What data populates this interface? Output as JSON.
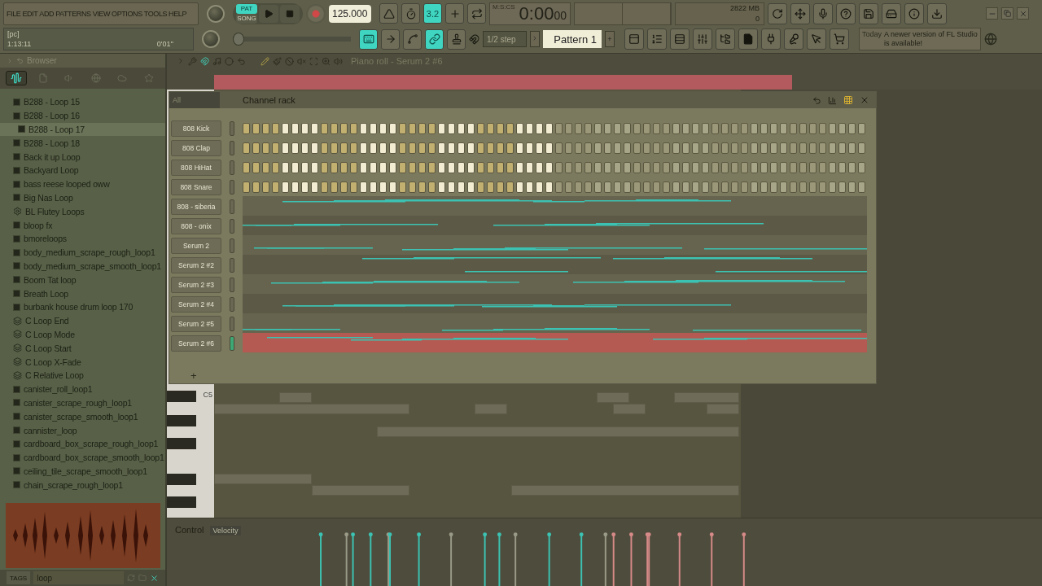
{
  "menu": [
    "FILE",
    "EDIT",
    "ADD",
    "PATTERNS",
    "VIEW",
    "OPTIONS",
    "TOOLS",
    "HELP"
  ],
  "hint": {
    "title": "[pc]",
    "position": "1:13:11",
    "time": "0'01''"
  },
  "modes": [
    {
      "label": "PAT",
      "selected": true
    },
    {
      "label": "SONG",
      "selected": false
    }
  ],
  "tempo": "125.000",
  "position": {
    "level": 0
  },
  "time": {
    "value": "0:00",
    "fraction": "00",
    "unit": "M:S:CS"
  },
  "tools_top": [
    {
      "kind": "metronome",
      "on": false
    },
    {
      "kind": "wait",
      "on": false
    },
    {
      "kind": "countdown",
      "on": true,
      "label": "3.2"
    },
    {
      "kind": "step-edit",
      "on": false
    },
    {
      "kind": "loop-record",
      "on": false
    }
  ],
  "memory": {
    "value": "2822 MB",
    "voices": "0"
  },
  "tools_bottom": [
    {
      "kind": "typing-keyboard",
      "on": true
    },
    {
      "kind": "arrow",
      "on": false
    },
    {
      "kind": "blend",
      "on": false
    },
    {
      "kind": "link",
      "on": true
    },
    {
      "kind": "stamp",
      "on": false
    }
  ],
  "snap": "1/2 step",
  "pattern": {
    "name": "Pattern 1",
    "add": "+"
  },
  "news": {
    "date": "Today",
    "message": "A newer version of FL Studio is available!"
  },
  "browser": {
    "title": "Browser",
    "tabs": [
      {
        "kind": "all",
        "selected": true
      },
      {
        "kind": "files",
        "selected": false
      },
      {
        "kind": "speaker",
        "selected": false
      },
      {
        "kind": "globe",
        "selected": false
      },
      {
        "kind": "cloud",
        "selected": false
      },
      {
        "kind": "star",
        "selected": false
      }
    ],
    "items": [
      {
        "label": "B288 - Loop 15",
        "kind": "audio",
        "selected": false
      },
      {
        "label": "B288 - Loop 16",
        "kind": "audio",
        "selected": false
      },
      {
        "label": "B288 - Loop 17",
        "kind": "audio",
        "selected": true
      },
      {
        "label": "B288 - Loop 18",
        "kind": "audio",
        "selected": false
      },
      {
        "label": "Back it up Loop",
        "kind": "audio",
        "selected": false
      },
      {
        "label": "Backyard Loop",
        "kind": "audio",
        "selected": false
      },
      {
        "label": "bass reese looped oww",
        "kind": "audio",
        "selected": false
      },
      {
        "label": "Big Nas Loop",
        "kind": "audio",
        "selected": false
      },
      {
        "label": "BL Flutey Loops",
        "kind": "folder",
        "selected": false
      },
      {
        "label": "bloop fx",
        "kind": "audio",
        "selected": false
      },
      {
        "label": "bmoreloops",
        "kind": "audio",
        "selected": false
      },
      {
        "label": "body_medium_scrape_rough_loop1",
        "kind": "audio",
        "selected": false
      },
      {
        "label": "body_medium_scrape_smooth_loop1",
        "kind": "audio",
        "selected": false
      },
      {
        "label": "Boom Tat loop",
        "kind": "audio",
        "selected": false
      },
      {
        "label": "Breath Loop",
        "kind": "audio",
        "selected": false
      },
      {
        "label": "burbank house drum loop 170",
        "kind": "audio",
        "selected": false
      },
      {
        "label": "C Loop End",
        "kind": "preset",
        "selected": false
      },
      {
        "label": "C Loop Mode",
        "kind": "preset",
        "selected": false
      },
      {
        "label": "C Loop Start",
        "kind": "preset",
        "selected": false
      },
      {
        "label": "C Loop X-Fade",
        "kind": "preset",
        "selected": false
      },
      {
        "label": "C Relative Loop",
        "kind": "preset",
        "selected": false
      },
      {
        "label": "canister_roll_loop1",
        "kind": "audio",
        "selected": false
      },
      {
        "label": "canister_scrape_rough_loop1",
        "kind": "audio",
        "selected": false
      },
      {
        "label": "canister_scrape_smooth_loop1",
        "kind": "audio",
        "selected": false
      },
      {
        "label": "cannister_loop",
        "kind": "audio",
        "selected": false
      },
      {
        "label": "cardboard_box_scrape_rough_loop1",
        "kind": "audio",
        "selected": false
      },
      {
        "label": "cardboard_box_scrape_smooth_loop1",
        "kind": "audio",
        "selected": false
      },
      {
        "label": "ceiling_tile_scrape_smooth_loop1",
        "kind": "audio",
        "selected": false
      },
      {
        "label": "chain_scrape_rough_loop1",
        "kind": "audio",
        "selected": false
      }
    ],
    "tags": "TAGS",
    "search": "loop"
  },
  "piano_roll": {
    "title": "Piano roll - Serum 2 #6",
    "key_label": "C5",
    "control": "Control",
    "control_target": "Velocity"
  },
  "channel_rack": {
    "filter": "All",
    "title": "Channel rack",
    "add": "+",
    "channels": [
      {
        "name": "808 Kick",
        "kind": "steps",
        "selected": false
      },
      {
        "name": "808 Clap",
        "kind": "steps",
        "selected": false
      },
      {
        "name": "808 HiHat",
        "kind": "steps",
        "selected": false
      },
      {
        "name": "808 Snare",
        "kind": "steps",
        "selected": false
      },
      {
        "name": "808 - siberia",
        "kind": "notes",
        "selected": false
      },
      {
        "name": "808 - onix",
        "kind": "notes",
        "selected": false
      },
      {
        "name": "Serum 2",
        "kind": "notes",
        "selected": false
      },
      {
        "name": "Serum 2 #2",
        "kind": "notes",
        "selected": false
      },
      {
        "name": "Serum 2 #3",
        "kind": "notes",
        "selected": false
      },
      {
        "name": "Serum 2 #4",
        "kind": "notes",
        "selected": false
      },
      {
        "name": "Serum 2 #5",
        "kind": "notes",
        "selected": false
      },
      {
        "name": "Serum 2 #6",
        "kind": "notes",
        "selected": true
      }
    ]
  }
}
